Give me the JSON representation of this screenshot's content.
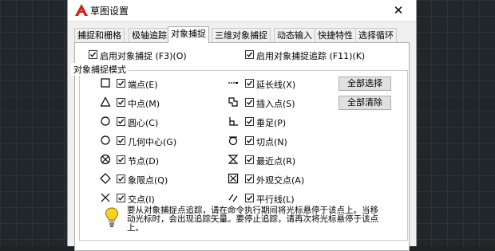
{
  "dialog": {
    "title": "草图设置",
    "close": "✕"
  },
  "tabs": [
    "捕捉和栅格",
    "极轴追踪",
    "对象捕捉",
    "三维对象捕捉",
    "动态输入",
    "快捷特性",
    "选择循环"
  ],
  "options": {
    "enable_snap": "启用对象捕捉 (F3)(O)",
    "enable_tracking": "启用对象捕捉追踪 (F11)(K)"
  },
  "modes_group": {
    "title": "对象捕捉模式",
    "select_all": "全部选择",
    "clear_all": "全部清除",
    "left": [
      {
        "label": "端点(E)",
        "checked": true,
        "icon": "endpoint-square"
      },
      {
        "label": "中点(M)",
        "checked": true,
        "icon": "midpoint-triangle"
      },
      {
        "label": "圆心(C)",
        "checked": true,
        "icon": "center-circle"
      },
      {
        "label": "几何中心(G)",
        "checked": true,
        "icon": "geometric-center-circle"
      },
      {
        "label": "节点(D)",
        "checked": true,
        "icon": "node-x-circle"
      },
      {
        "label": "象限点(Q)",
        "checked": true,
        "icon": "quadrant-diamond"
      },
      {
        "label": "交点(I)",
        "checked": true,
        "icon": "intersection-x"
      }
    ],
    "right": [
      {
        "label": "延长线(X)",
        "checked": true,
        "icon": "extension-dots"
      },
      {
        "label": "插入点(S)",
        "checked": true,
        "icon": "insertion-squares"
      },
      {
        "label": "垂足(P)",
        "checked": true,
        "icon": "perpendicular"
      },
      {
        "label": "切点(N)",
        "checked": true,
        "icon": "tangent-circle"
      },
      {
        "label": "最近点(R)",
        "checked": true,
        "icon": "nearest-hourglass"
      },
      {
        "label": "外观交点(A)",
        "checked": true,
        "icon": "apparent-intersection-box"
      },
      {
        "label": "平行线(L)",
        "checked": true,
        "icon": "parallel-lines"
      }
    ]
  },
  "hint": "要从对象捕捉点追踪，请在命令执行期间将光标悬停于该点上。当移动光标时，会出现追踪矢量。要停止追踪，请再次将光标悬停于该点上。"
}
